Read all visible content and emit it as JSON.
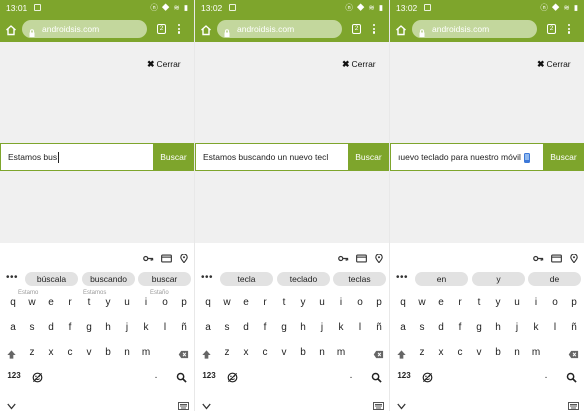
{
  "status": {
    "icons": "ⓝ ◆ ≋ ▮"
  },
  "browser": {
    "url": "androidsis.com",
    "tab_count": "2"
  },
  "page": {
    "close_label": "Cerrar",
    "search_button": "Buscar"
  },
  "keyboard": {
    "rows": [
      [
        "q",
        "w",
        "e",
        "r",
        "t",
        "y",
        "u",
        "i",
        "o",
        "p"
      ],
      [
        "a",
        "s",
        "d",
        "f",
        "g",
        "h",
        "j",
        "k",
        "l",
        "ñ"
      ],
      [
        "z",
        "x",
        "c",
        "v",
        "b",
        "n",
        "m"
      ]
    ],
    "numbers_key": "123",
    "period_key": "."
  },
  "panels": [
    {
      "time": "13:01",
      "query": "Estamos bus",
      "suggestions": [
        "búscala",
        "buscando",
        "buscar"
      ],
      "hints": [
        "Estamo",
        "Estamos",
        "Estaño"
      ]
    },
    {
      "time": "13:02",
      "query": "Estamos buscando un nuevo tecl",
      "suggestions": [
        "tecla",
        "teclado",
        "teclas"
      ],
      "hints": []
    },
    {
      "time": "13:02",
      "query": "ıuevo teclado para nuestro móvil",
      "suggestions": [
        "en",
        "y",
        "de"
      ],
      "hints": []
    }
  ],
  "colors": {
    "brand_green": "#7ea52c",
    "url_bar": "#c3d79d",
    "page_bg": "#f0f0f0",
    "chip_bg": "#e2e2e2",
    "phone_emoji_blue": "#3c78d8"
  },
  "icons": [
    "home-icon",
    "lock-icon",
    "tabs-icon",
    "overflow-menu-icon",
    "close-icon",
    "key-icon",
    "credit-card-icon",
    "location-pin-icon",
    "more-suggestions-icon",
    "shift-icon",
    "backspace-icon",
    "emoji-icon",
    "keyboard-search-icon",
    "nav-back-icon",
    "keyboard-hide-icon",
    "mobile-phone-emoji"
  ]
}
